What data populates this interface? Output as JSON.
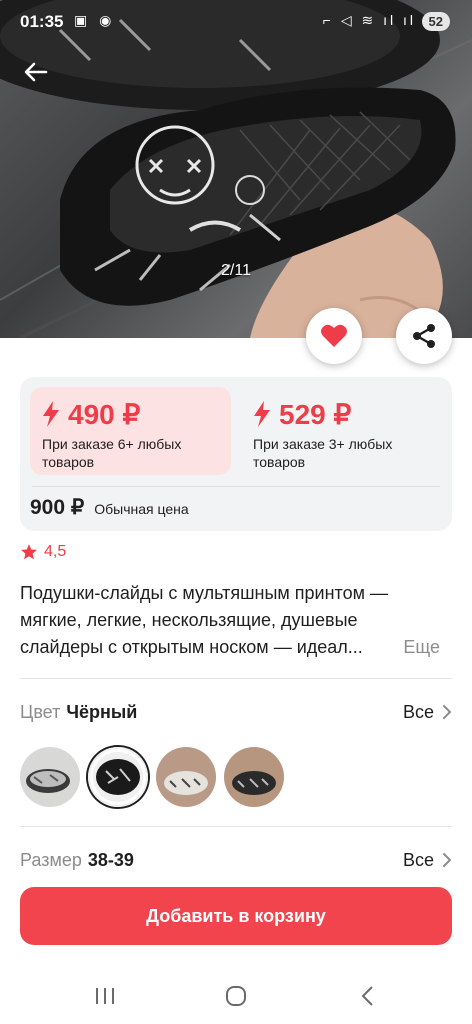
{
  "status": {
    "time": "01:35",
    "battery": "52"
  },
  "gallery": {
    "counter": "2/11"
  },
  "prices": [
    {
      "amount": "490 ₽",
      "note": "При заказе 6+ любых товаров"
    },
    {
      "amount": "529 ₽",
      "note": "При заказе 3+ любых товаров"
    }
  ],
  "regular": {
    "amount": "900 ₽",
    "label": "Обычная цена"
  },
  "rating": "4,5",
  "description": {
    "line1": "Подушки-слайды с мультяшным принтом —",
    "line2": "мягкие, легкие, нескользящие, душевые",
    "line3": "слайдеры с открытым носком — идеал...",
    "more": "Еще"
  },
  "color": {
    "label": "Цвет",
    "value": "Чёрный",
    "all": "Все"
  },
  "size": {
    "label": "Размер",
    "value": "38-39",
    "all": "Все"
  },
  "cta": "Добавить в корзину",
  "colors": {
    "accent": "#f1444c",
    "price_red": "#ee3d48",
    "promo_bg": "#fde2e4"
  },
  "icons": [
    "back-arrow-icon",
    "heart-icon",
    "share-icon",
    "lightning-icon",
    "star-icon",
    "chevron-right-icon"
  ]
}
